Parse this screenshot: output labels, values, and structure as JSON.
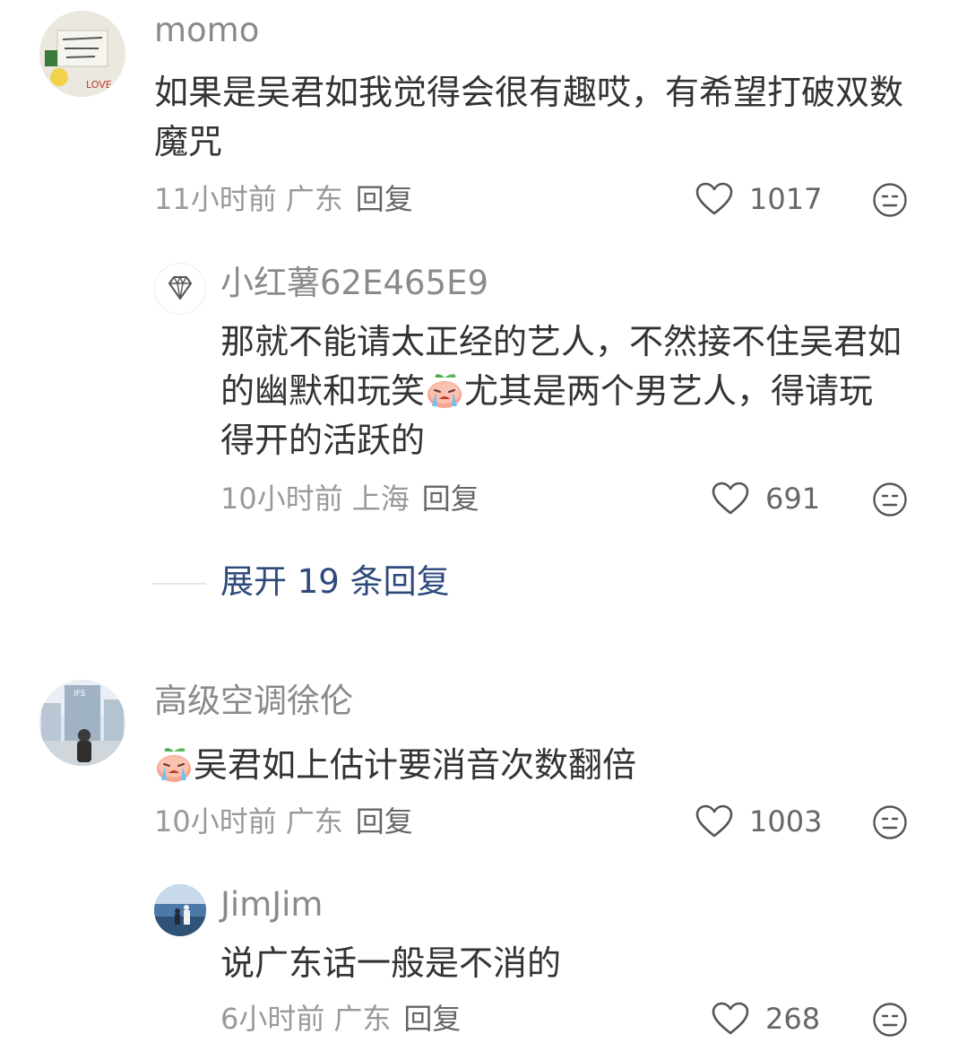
{
  "comments": [
    {
      "username": "momo",
      "text": "如果是吴君如我觉得会很有趣哎，有希望打破双数魔咒",
      "time": "11小时前",
      "location": "广东",
      "reply_label": "回复",
      "likes": "1017",
      "avatar_text": "LOVE"
    },
    {
      "username": "小红薯62E465E9",
      "text_part1": "那就不能请太正经的艺人，不然接不住吴君如的幽默和玩笑",
      "text_part2": "尤其是两个男艺人，得请玩得开的活跃的",
      "time": "10小时前",
      "location": "上海",
      "reply_label": "回复",
      "likes": "691"
    },
    {
      "username": "高级空调徐伦",
      "text": "吴君如上估计要消音次数翻倍",
      "time": "10小时前",
      "location": "广东",
      "reply_label": "回复",
      "likes": "1003",
      "avatar_text": "IFS"
    },
    {
      "username": "JimJim",
      "text": "说广东话一般是不消的",
      "time": "6小时前",
      "location": "广东",
      "reply_label": "回复",
      "likes": "268"
    }
  ],
  "expand_replies": "展开 19 条回复",
  "icons": {
    "like": "heart-outline-icon",
    "emoji": "neutral-face-icon",
    "sticker": "crying-peach-emoji",
    "badge": "diamond-icon"
  },
  "colors": {
    "link": "#2e4a7d",
    "text": "#333333",
    "meta": "#999999",
    "name": "#8a8a8a"
  }
}
